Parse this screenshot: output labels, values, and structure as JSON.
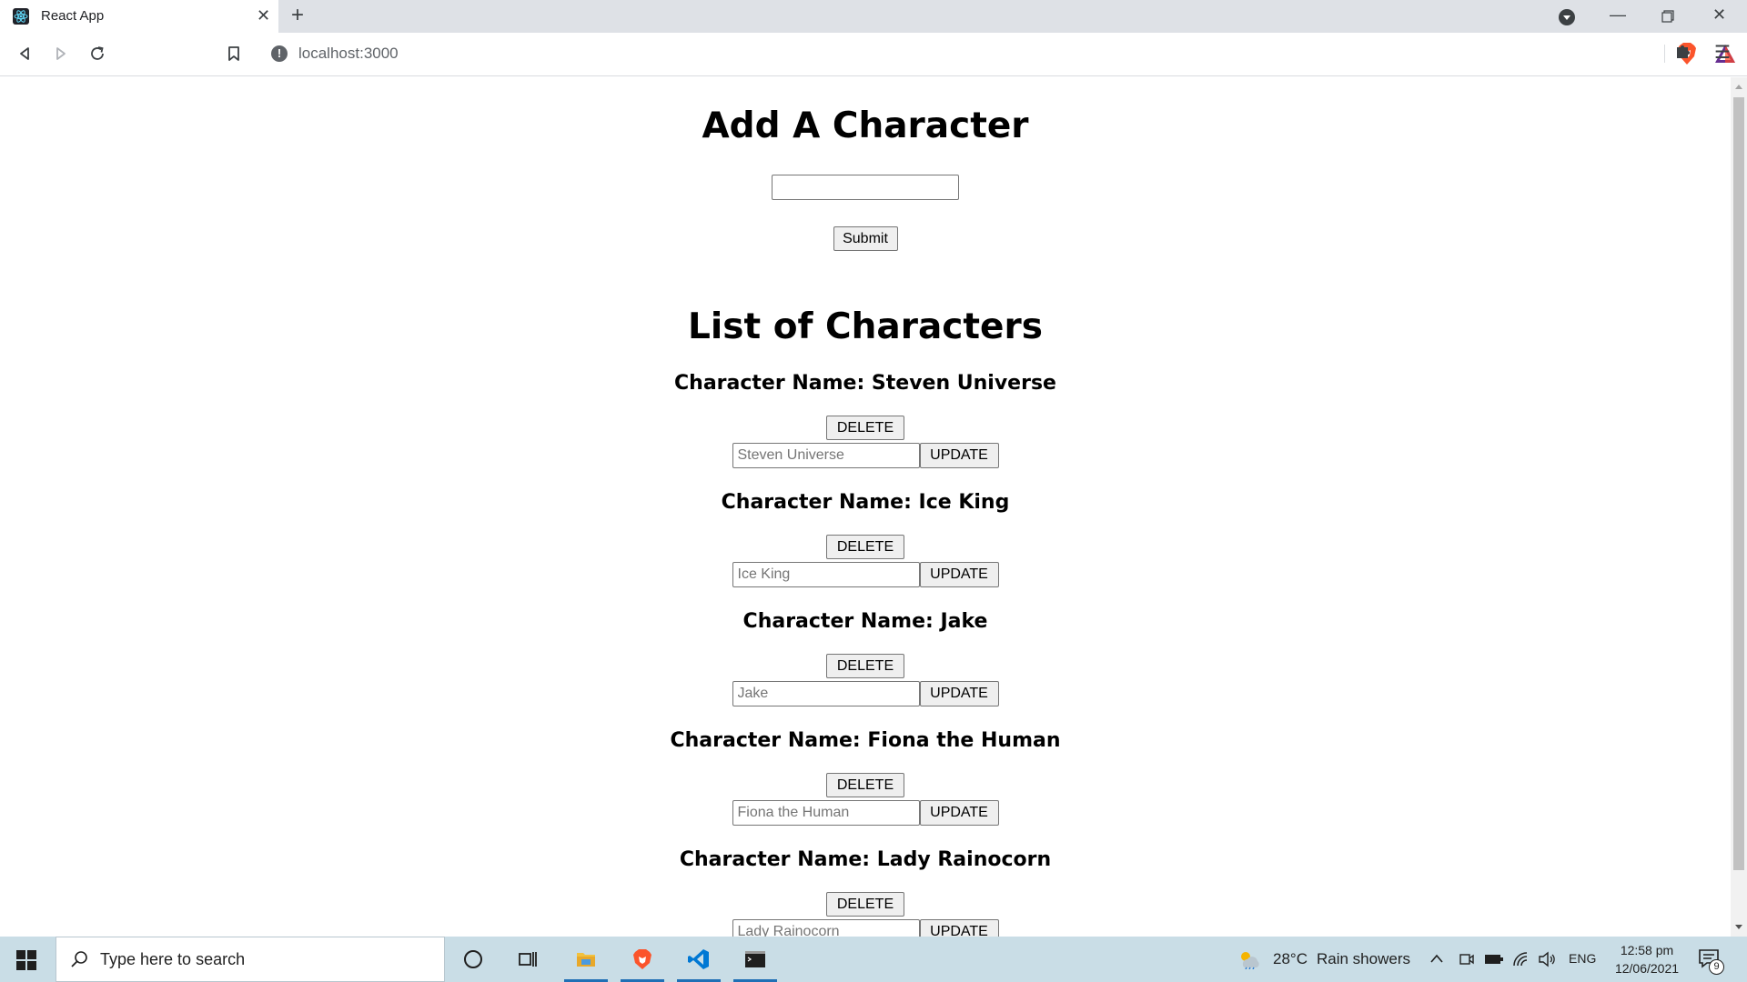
{
  "browser": {
    "tab_title": "React App",
    "url": "localhost:3000",
    "new_tab_label": "+",
    "close_label": "✕"
  },
  "page": {
    "add_title": "Add A Character",
    "add_input_value": "",
    "submit_label": "Submit",
    "list_title": "List of Characters",
    "name_prefix": "Character Name: ",
    "delete_label": "DELETE",
    "update_label": "UPDATE",
    "characters": [
      {
        "heading": "Character Name: Steven Universe",
        "placeholder": "Steven Universe"
      },
      {
        "heading": "Character Name: Ice King",
        "placeholder": "Ice King"
      },
      {
        "heading": "Character Name: Jake",
        "placeholder": "Jake"
      },
      {
        "heading": "Character Name: Fiona the Human",
        "placeholder": "Fiona the Human"
      },
      {
        "heading": "Character Name: Lady Rainocorn",
        "placeholder": "Lady Rainocorn"
      }
    ]
  },
  "taskbar": {
    "search_placeholder": "Type here to search",
    "weather_temp": "28°C",
    "weather_desc": "Rain showers",
    "language": "ENG",
    "time": "12:58 pm",
    "date": "12/06/2021",
    "notification_count": "9"
  },
  "icons": {
    "tab_favicon": "react-icon",
    "back": "back-icon",
    "forward": "forward-icon",
    "reload": "reload-icon",
    "bookmark": "bookmark-icon",
    "extensions": "puzzle-icon",
    "menu": "menu-icon"
  },
  "colors": {
    "brave_orange": "#fb542b",
    "vscode_blue": "#0078d4",
    "taskbar_bg": "#c9dde6"
  }
}
